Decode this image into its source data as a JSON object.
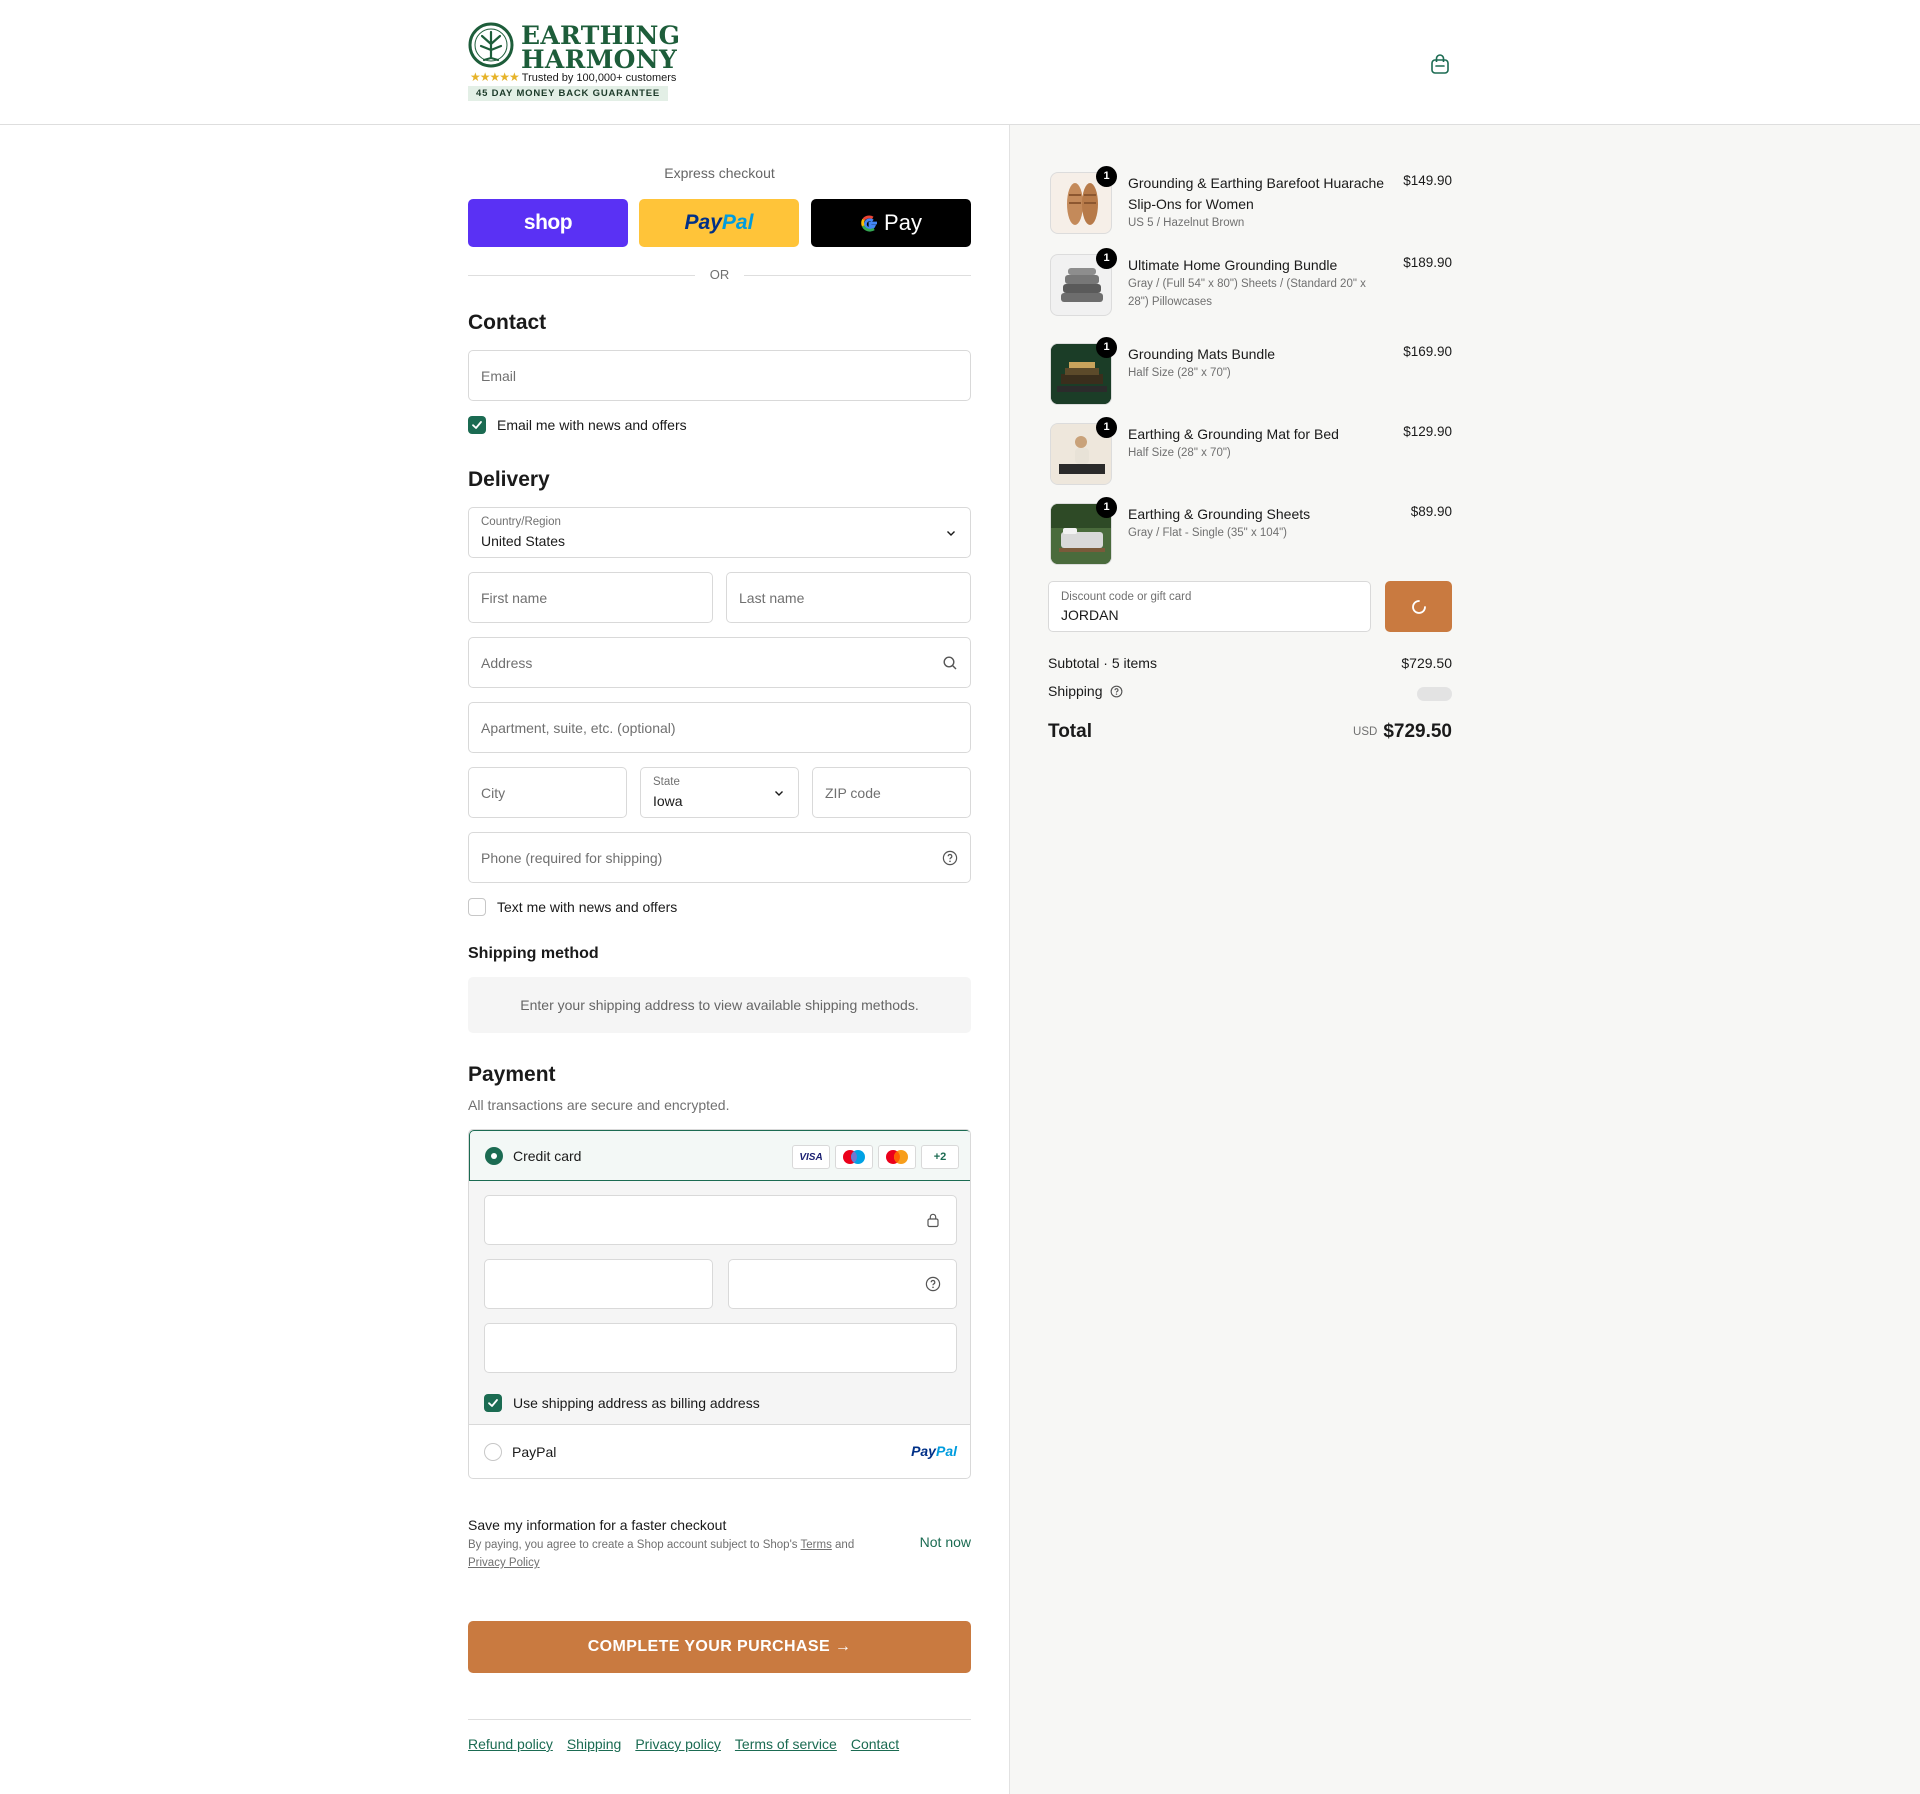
{
  "brand": {
    "name_line1": "EARTHING",
    "name_line2": "HARMONY",
    "stars": "★★★★★",
    "trust": "Trusted by 100,000+ customers",
    "guarantee": "45 DAY MONEY BACK GUARANTEE"
  },
  "icons": {
    "cart": "shopping-bag-icon",
    "search": "search-icon",
    "help": "question-circle-icon",
    "lock": "lock-icon",
    "chevron": "chevron-down-icon",
    "spinner": "loading-spinner-icon",
    "check": "checkmark-icon"
  },
  "colors": {
    "brand_green": "#1d5d3a",
    "accent_green": "#1b6b52",
    "cta_orange": "#c97a40",
    "shop_purple": "#5a31f4",
    "paypal_yellow": "#ffc439"
  },
  "express": {
    "label": "Express checkout",
    "shop": "shop",
    "paypal_pay": "Pay",
    "paypal_pal": "Pal",
    "gpay": "Pay",
    "or": "OR"
  },
  "contact": {
    "title": "Contact",
    "email_placeholder": "Email",
    "news_label": "Email me with news and offers",
    "news_checked": true
  },
  "delivery": {
    "title": "Delivery",
    "country_label": "Country/Region",
    "country_value": "United States",
    "first_name": "First name",
    "last_name": "Last name",
    "address": "Address",
    "apartment": "Apartment, suite, etc. (optional)",
    "city": "City",
    "state_label": "State",
    "state_value": "Iowa",
    "zip": "ZIP code",
    "phone": "Phone (required for shipping)",
    "sms_label": "Text me with news and offers",
    "sms_checked": false
  },
  "shipping_method": {
    "title": "Shipping method",
    "message": "Enter your shipping address to view available shipping methods."
  },
  "payment": {
    "title": "Payment",
    "subtitle": "All transactions are secure and encrypted.",
    "credit_card_label": "Credit card",
    "cards": [
      "VISA",
      "maestro",
      "mastercard",
      "+2"
    ],
    "billing_label": "Use shipping address as billing address",
    "billing_checked": true,
    "paypal_label": "PayPal",
    "paypal_logo_pay": "Pay",
    "paypal_logo_pal": "Pal"
  },
  "save_info": {
    "title": "Save my information for a faster checkout",
    "text_before": "By paying, you agree to create a Shop account subject to Shop's ",
    "terms": "Terms",
    "and": " and ",
    "privacy": "Privacy Policy",
    "not_now": "Not now"
  },
  "complete_button": "COMPLETE YOUR PURCHASE →",
  "footer_links": [
    "Refund policy",
    "Shipping",
    "Privacy policy",
    "Terms of service",
    "Contact"
  ],
  "order": {
    "items": [
      {
        "name": "Grounding & Earthing Barefoot Huarache Slip-Ons for Women",
        "variant": "US 5 / Hazelnut Brown",
        "price": "$149.90",
        "qty": "1",
        "thumb": "sandals"
      },
      {
        "name": "Ultimate Home Grounding Bundle",
        "variant": "Gray / (Full 54\" x 80\") Sheets / (Standard 20\" x 28\") Pillowcases",
        "price": "$189.90",
        "qty": "1",
        "thumb": "stack"
      },
      {
        "name": "Grounding Mats Bundle",
        "variant": "Half Size (28\" x 70\")",
        "price": "$169.90",
        "qty": "1",
        "thumb": "mats"
      },
      {
        "name": "Earthing & Grounding Mat for Bed",
        "variant": "Half Size (28\" x 70\")",
        "price": "$129.90",
        "qty": "1",
        "thumb": "bed"
      },
      {
        "name": "Earthing & Grounding Sheets",
        "variant": "Gray / Flat - Single (35\" x 104\")",
        "price": "$89.90",
        "qty": "1",
        "thumb": "sheets"
      }
    ],
    "discount_label": "Discount code or gift card",
    "discount_value": "JORDAN",
    "subtotal_label": "Subtotal · 5 items",
    "subtotal_value": "$729.50",
    "shipping_label": "Shipping",
    "total_label": "Total",
    "currency": "USD",
    "total_value": "$729.50"
  }
}
